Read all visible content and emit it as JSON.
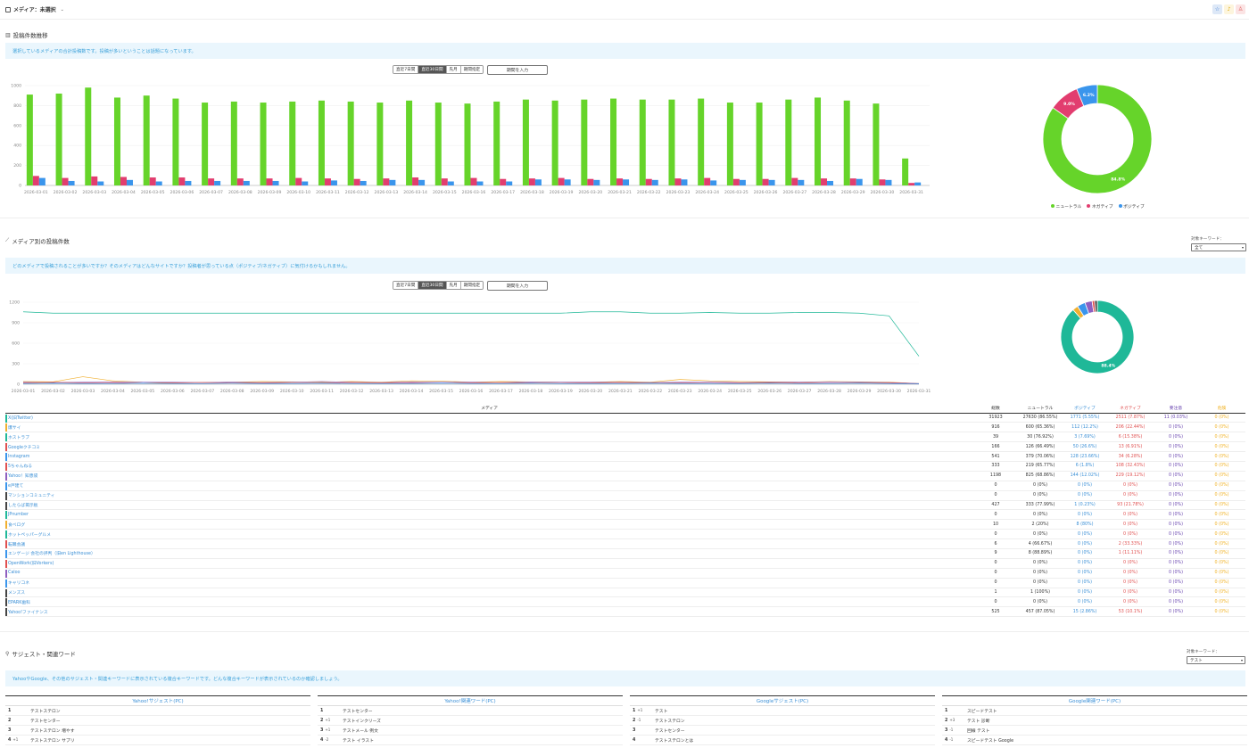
{
  "header": {
    "media_label": "メディア：未選択",
    "icons": [
      "star-icon",
      "bell-icon",
      "user-icon"
    ]
  },
  "section1": {
    "title": "投稿件数推移",
    "notice": "選択しているメディアの合計投稿数です。投稿が多いということは話題になっています。",
    "buttons": [
      "直近7日間",
      "直近30日間",
      "先月",
      "期間指定"
    ],
    "active_button": 1,
    "date_placeholder": "期間を入力"
  },
  "section2": {
    "title": "メディア別の投稿件数",
    "notice": "どのメディアで投稿されることが多いですか？そのメディアはどんなサイトですか？投稿者が思っている点（ポジティブ/ネガティブ）に気付けるかもしれません。",
    "keyword_label": "対象キーワード：",
    "keyword_value": "全て",
    "buttons": [
      "直近7日間",
      "直近30日間",
      "先月",
      "期間指定"
    ],
    "active_button": 1,
    "date_placeholder": "期間を入力"
  },
  "section3": {
    "title": "サジェスト・関連ワード",
    "notice": "YahooやGoogle、その他のサジェスト・関連キーワードに表示されている複合キーワードです。どんな複合キーワードが表示されているのか確認しましょう。",
    "keyword_label": "対象キーワード：",
    "keyword_value": "テスト"
  },
  "chart_data": [
    {
      "type": "bar",
      "categories": [
        "2026-03-01",
        "2026-03-02",
        "2026-03-03",
        "2026-03-04",
        "2026-03-05",
        "2026-03-06",
        "2026-03-07",
        "2026-03-08",
        "2026-03-09",
        "2026-03-10",
        "2026-03-11",
        "2026-03-12",
        "2026-03-13",
        "2026-03-14",
        "2026-03-15",
        "2026-03-16",
        "2026-03-17",
        "2026-03-18",
        "2026-03-19",
        "2026-03-20",
        "2026-03-21",
        "2026-03-22",
        "2026-03-23",
        "2026-03-24",
        "2026-03-25",
        "2026-03-26",
        "2026-03-27",
        "2026-03-28",
        "2026-03-29",
        "2026-03-30",
        "2026-03-31"
      ],
      "series": [
        {
          "name": "ニュートラル",
          "color": "#66d42a",
          "values": [
            910,
            920,
            980,
            880,
            900,
            870,
            830,
            840,
            830,
            840,
            850,
            840,
            830,
            850,
            830,
            820,
            840,
            860,
            850,
            860,
            870,
            860,
            860,
            870,
            830,
            830,
            860,
            880,
            850,
            820,
            270
          ]
        },
        {
          "name": "ネガティブ",
          "color": "#e23d6f",
          "values": [
            95,
            75,
            90,
            85,
            80,
            80,
            70,
            70,
            70,
            75,
            70,
            65,
            70,
            80,
            70,
            75,
            65,
            70,
            75,
            65,
            70,
            65,
            70,
            75,
            65,
            65,
            75,
            70,
            70,
            60,
            25
          ]
        },
        {
          "name": "ポジティブ",
          "color": "#3a95ec",
          "values": [
            75,
            45,
            40,
            55,
            40,
            45,
            45,
            45,
            45,
            40,
            50,
            45,
            55,
            55,
            40,
            40,
            40,
            60,
            60,
            55,
            60,
            55,
            60,
            50,
            55,
            55,
            55,
            45,
            65,
            55,
            30
          ]
        }
      ],
      "ylim": [
        0,
        1000
      ],
      "yticks": [
        0,
        200,
        400,
        600,
        800,
        1000
      ]
    },
    {
      "type": "pie",
      "slices": [
        {
          "name": "ニュートラル",
          "value": 84.8,
          "label": "84.8%",
          "color": "#66d42a"
        },
        {
          "name": "ネガティブ",
          "value": 9.0,
          "label": "9.0%",
          "color": "#e23d6f"
        },
        {
          "name": "ポジティブ",
          "value": 6.2,
          "label": "6.2%",
          "color": "#3a95ec"
        }
      ],
      "legend": "bottom"
    },
    {
      "type": "line",
      "categories": [
        "2026-03-01",
        "2026-03-02",
        "2026-03-03",
        "2026-03-04",
        "2026-03-05",
        "2026-03-06",
        "2026-03-07",
        "2026-03-08",
        "2026-03-09",
        "2026-03-10",
        "2026-03-11",
        "2026-03-12",
        "2026-03-13",
        "2026-03-14",
        "2026-03-15",
        "2026-03-16",
        "2026-03-17",
        "2026-03-18",
        "2026-03-19",
        "2026-03-20",
        "2026-03-21",
        "2026-03-22",
        "2026-03-23",
        "2026-03-24",
        "2026-03-25",
        "2026-03-26",
        "2026-03-27",
        "2026-03-28",
        "2026-03-29",
        "2026-03-30",
        "2026-03-31"
      ],
      "series": [
        {
          "color": "#1fb898",
          "values": [
            1060,
            1040,
            1040,
            1040,
            1040,
            1040,
            1040,
            1040,
            1040,
            1040,
            1040,
            1040,
            1040,
            1040,
            1040,
            1040,
            1040,
            1040,
            1040,
            1060,
            1060,
            1040,
            1040,
            1050,
            1040,
            1040,
            1050,
            1050,
            1040,
            1000,
            410
          ]
        },
        {
          "color": "#f0b030",
          "values": [
            40,
            35,
            110,
            50,
            30,
            20,
            25,
            30,
            40,
            35,
            30,
            40,
            30,
            50,
            45,
            30,
            40,
            35,
            30,
            30,
            40,
            30,
            70,
            50,
            40,
            35,
            30,
            40,
            35,
            30,
            10
          ]
        },
        {
          "color": "#8e5fc0",
          "values": [
            30,
            25,
            30,
            35,
            30,
            30,
            25,
            30,
            25,
            30,
            40,
            30,
            25,
            35,
            30,
            30,
            25,
            35,
            30,
            30,
            30,
            25,
            30,
            35,
            25,
            30,
            30,
            35,
            30,
            25,
            10
          ]
        },
        {
          "color": "#e05050",
          "values": [
            20,
            30,
            20,
            25,
            15,
            20,
            25,
            20,
            20,
            15,
            20,
            25,
            20,
            20,
            15,
            20,
            25,
            20,
            15,
            20,
            25,
            20,
            20,
            15,
            20,
            25,
            20,
            15,
            20,
            20,
            5
          ]
        },
        {
          "color": "#3a95ec",
          "values": [
            10,
            15,
            10,
            10,
            15,
            10,
            10,
            15,
            10,
            10,
            15,
            10,
            10,
            10,
            15,
            10,
            10,
            15,
            10,
            10,
            10,
            15,
            10,
            10,
            10,
            15,
            10,
            10,
            15,
            10,
            5
          ]
        }
      ],
      "ylim": [
        0,
        1200
      ],
      "yticks": [
        0,
        300,
        600,
        900,
        1200
      ]
    },
    {
      "type": "pie",
      "slices": [
        {
          "value": 88.4,
          "label": "88.4%",
          "color": "#1fb898"
        },
        {
          "value": 2.5,
          "label": "",
          "color": "#f0b030"
        },
        {
          "value": 3.6,
          "label": "",
          "color": "#3a95ec"
        },
        {
          "value": 3.2,
          "label": "",
          "color": "#8e5fc0"
        },
        {
          "value": 1.1,
          "label": "",
          "color": "#e05050"
        },
        {
          "value": 1.2,
          "label": "",
          "color": "#444444"
        }
      ]
    }
  ],
  "table": {
    "headers": [
      "メディア",
      "総数",
      "ニュートラル",
      "ポジティブ",
      "ネガティブ",
      "要注意",
      "危険"
    ],
    "rows": [
      {
        "name": "X(旧Twitter)",
        "color": "#1fb898",
        "total": "31923",
        "neutral": "27630 (86.55%)",
        "positive": "1771 (5.55%)",
        "negative": "2511 (7.87%)",
        "warn": "11 (0.03%)",
        "danger": "0 (0%)"
      },
      {
        "name": "爆サイ",
        "color": "#f0b030",
        "total": "916",
        "neutral": "600 (65.36%)",
        "positive": "112 (12.2%)",
        "negative": "206 (22.44%)",
        "warn": "0 (0%)",
        "danger": "0 (0%)"
      },
      {
        "name": "ホストラブ",
        "color": "#1fb898",
        "total": "39",
        "neutral": "30 (76.92%)",
        "positive": "3 (7.69%)",
        "negative": "6 (15.38%)",
        "warn": "0 (0%)",
        "danger": "0 (0%)"
      },
      {
        "name": "Googleクチコミ",
        "color": "#e05050",
        "total": "166",
        "neutral": "126 (66.49%)",
        "positive": "50 (26.6%)",
        "negative": "13 (6.91%)",
        "warn": "0 (0%)",
        "danger": "0 (0%)"
      },
      {
        "name": "Instagram",
        "color": "#3a95ec",
        "total": "541",
        "neutral": "379 (70.06%)",
        "positive": "128 (23.66%)",
        "negative": "34 (6.28%)",
        "warn": "0 (0%)",
        "danger": "0 (0%)"
      },
      {
        "name": "5ちゃんねる",
        "color": "#e05050",
        "total": "333",
        "neutral": "219 (65.77%)",
        "positive": "6 (1.8%)",
        "negative": "108 (32.43%)",
        "warn": "0 (0%)",
        "danger": "0 (0%)"
      },
      {
        "name": "Yahoo！知恵袋",
        "color": "#8e5fc0",
        "total": "1198",
        "neutral": "825 (68.86%)",
        "positive": "144 (12.02%)",
        "negative": "229 (19.12%)",
        "warn": "0 (0%)",
        "danger": "0 (0%)"
      },
      {
        "name": "e戸建て",
        "color": "#3a95ec",
        "total": "0",
        "neutral": "0 (0%)",
        "positive": "0 (0%)",
        "negative": "0 (0%)",
        "warn": "0 (0%)",
        "danger": "0 (0%)"
      },
      {
        "name": "マンションコミュニティ",
        "color": "#444444",
        "total": "0",
        "neutral": "0 (0%)",
        "positive": "0 (0%)",
        "negative": "0 (0%)",
        "warn": "0 (0%)",
        "danger": "0 (0%)"
      },
      {
        "name": "したらば掲示板",
        "color": "#444444",
        "total": "427",
        "neutral": "333 (77.99%)",
        "positive": "1 (0.23%)",
        "negative": "93 (21.78%)",
        "warn": "0 (0%)",
        "danger": "0 (0%)"
      },
      {
        "name": "JPnumber",
        "color": "#1fb898",
        "total": "0",
        "neutral": "0 (0%)",
        "positive": "0 (0%)",
        "negative": "0 (0%)",
        "warn": "0 (0%)",
        "danger": "0 (0%)"
      },
      {
        "name": "食べログ",
        "color": "#f0b030",
        "total": "10",
        "neutral": "2 (20%)",
        "positive": "8 (80%)",
        "negative": "0 (0%)",
        "warn": "0 (0%)",
        "danger": "0 (0%)"
      },
      {
        "name": "ホットペッパーグルメ",
        "color": "#1fb898",
        "total": "0",
        "neutral": "0 (0%)",
        "positive": "0 (0%)",
        "negative": "0 (0%)",
        "warn": "0 (0%)",
        "danger": "0 (0%)"
      },
      {
        "name": "転職会議",
        "color": "#e05050",
        "total": "6",
        "neutral": "4 (66.67%)",
        "positive": "0 (0%)",
        "negative": "2 (33.33%)",
        "warn": "0 (0%)",
        "danger": "0 (0%)"
      },
      {
        "name": "エンゲージ 会社の評判（旧en Lighthouse）",
        "color": "#3a95ec",
        "total": "9",
        "neutral": "8 (88.89%)",
        "positive": "0 (0%)",
        "negative": "1 (11.11%)",
        "warn": "0 (0%)",
        "danger": "0 (0%)"
      },
      {
        "name": "OpenWork(旧Vorkers)",
        "color": "#e05050",
        "total": "0",
        "neutral": "0 (0%)",
        "positive": "0 (0%)",
        "negative": "0 (0%)",
        "warn": "0 (0%)",
        "danger": "0 (0%)"
      },
      {
        "name": "Caloo",
        "color": "#8e5fc0",
        "total": "0",
        "neutral": "0 (0%)",
        "positive": "0 (0%)",
        "negative": "0 (0%)",
        "warn": "0 (0%)",
        "danger": "0 (0%)"
      },
      {
        "name": "キャリコネ",
        "color": "#3a95ec",
        "total": "0",
        "neutral": "0 (0%)",
        "positive": "0 (0%)",
        "negative": "0 (0%)",
        "warn": "0 (0%)",
        "danger": "0 (0%)"
      },
      {
        "name": "メンズス",
        "color": "#444444",
        "total": "1",
        "neutral": "1 (100%)",
        "positive": "0 (0%)",
        "negative": "0 (0%)",
        "warn": "0 (0%)",
        "danger": "0 (0%)"
      },
      {
        "name": "EPARK歯科",
        "color": "#444444",
        "total": "0",
        "neutral": "0 (0%)",
        "positive": "0 (0%)",
        "negative": "0 (0%)",
        "warn": "0 (0%)",
        "danger": "0 (0%)"
      },
      {
        "name": "Yahoo!ファイナンス",
        "color": "#444444",
        "total": "525",
        "neutral": "457 (87.05%)",
        "positive": "15 (2.86%)",
        "negative": "53 (10.1%)",
        "warn": "0 (0%)",
        "danger": "0 (0%)"
      }
    ]
  },
  "suggest": [
    {
      "title": "Yahoo!サジェスト(PC)",
      "rows": [
        {
          "rank": "1",
          "change": "",
          "kw": "テストステロン"
        },
        {
          "rank": "2",
          "change": "",
          "kw": "テストセンター"
        },
        {
          "rank": "3",
          "change": "",
          "kw": "テストステロン 増やす"
        },
        {
          "rank": "4",
          "change": "+1",
          "kw": "テストステロン サプリ"
        }
      ]
    },
    {
      "title": "Yahoo!関連ワード(PC)",
      "rows": [
        {
          "rank": "1",
          "change": "",
          "kw": "テストセンター"
        },
        {
          "rank": "2",
          "change": "+1",
          "kw": "テストインクリーズ"
        },
        {
          "rank": "3",
          "change": "+1",
          "kw": "テストメール 例文"
        },
        {
          "rank": "4",
          "change": "-2",
          "kw": "テスト イラスト"
        }
      ]
    },
    {
      "title": "Googleサジェスト(PC)",
      "rows": [
        {
          "rank": "1",
          "change": "+1",
          "kw": "テスト"
        },
        {
          "rank": "2",
          "change": "-1",
          "kw": "テストステロン"
        },
        {
          "rank": "3",
          "change": "",
          "kw": "テストセンター"
        },
        {
          "rank": "4",
          "change": "",
          "kw": "テストステロンとは"
        }
      ]
    },
    {
      "title": "Google関連ワード(PC)",
      "rows": [
        {
          "rank": "1",
          "change": "",
          "kw": "スピードテスト"
        },
        {
          "rank": "2",
          "change": "+3",
          "kw": "テスト 診断"
        },
        {
          "rank": "3",
          "change": "-1",
          "kw": "回線 テスト"
        },
        {
          "rank": "4",
          "change": "-1",
          "kw": "スピードテスト Google"
        }
      ]
    }
  ]
}
